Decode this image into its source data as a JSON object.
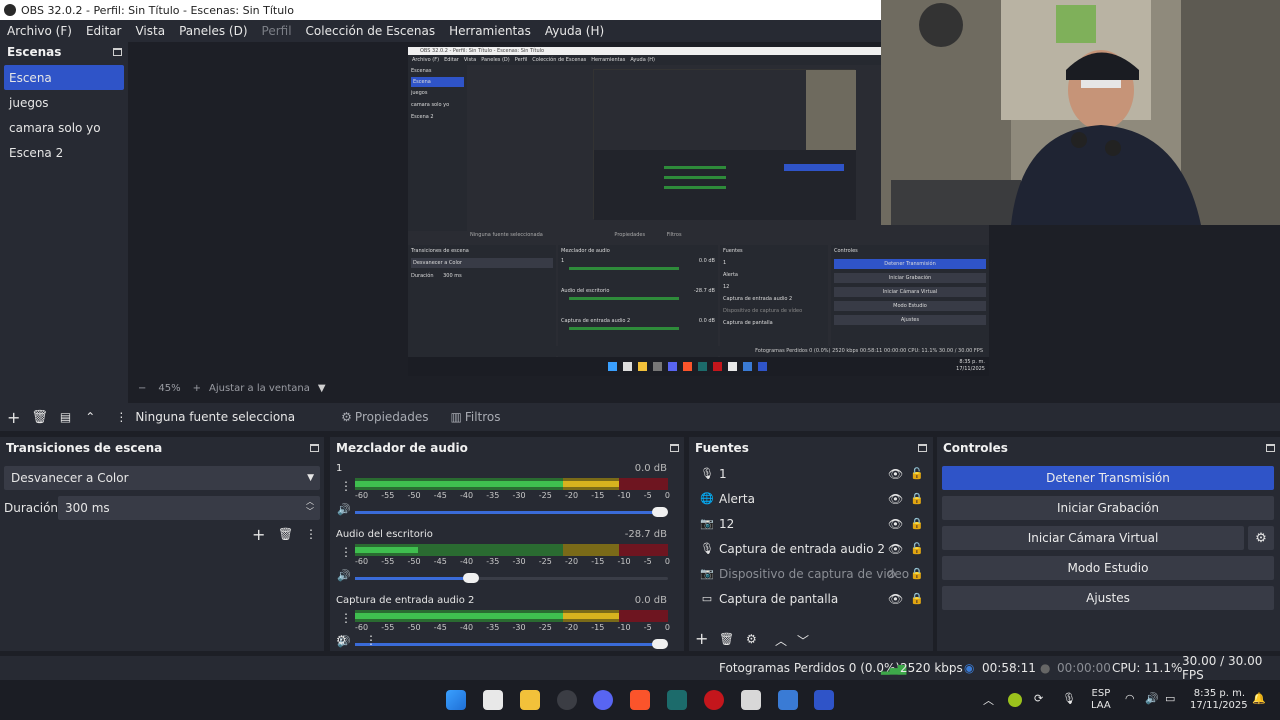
{
  "window": {
    "title": "OBS 32.0.2 - Perfil: Sin Título - Escenas: Sin Título"
  },
  "menu": {
    "items": [
      "Archivo (F)",
      "Editar",
      "Vista",
      "Paneles (D)",
      "Perfil",
      "Colección de Escenas",
      "Herramientas",
      "Ayuda (H)"
    ]
  },
  "scenes": {
    "title": "Escenas",
    "items": [
      "Escena",
      "juegos",
      "camara solo yo",
      "Escena 2"
    ]
  },
  "preview": {
    "zoom_minus": "−",
    "zoom": "45%",
    "zoom_plus": "+",
    "fit": "Ajustar a la ventana"
  },
  "nested": {
    "title": "OBS 32.0.2 - Perfil: Sin Título - Escenas: Sin Título",
    "menu": [
      "Archivo (F)",
      "Editar",
      "Vista",
      "Paneles (D)",
      "Perfil",
      "Colección de Escenas",
      "Herramientas",
      "Ayuda (H)"
    ],
    "scenes_title": "Escenas",
    "scenes": [
      "Escena",
      "juegos",
      "camara solo yo",
      "Escena 2"
    ],
    "no_source": "Ninguna fuente seleccionada",
    "props": "Propiedades",
    "filters": "Filtros",
    "trans_title": "Transiciones de escena",
    "trans_value": "Desvanecer a Color",
    "duration_label": "Duración",
    "duration_value": "300 ms",
    "mixer_title": "Mezclador de audio",
    "mixer_ch1": "1",
    "mixer_ch1_db": "0.0 dB",
    "mixer_ch2": "Audio del escritorio",
    "mixer_ch2_db": "-28.7 dB",
    "mixer_ch3": "Captura de entrada audio 2",
    "mixer_ch3_db": "0.0 dB",
    "sources_title": "Fuentes",
    "sources": [
      "1",
      "Alerta",
      "12",
      "Captura de entrada audio 2",
      "Dispositivo de captura de vídeo",
      "Captura de pantalla"
    ],
    "controls_title": "Controles",
    "controls": [
      "Detener Transmisión",
      "Iniciar Grabación",
      "Iniciar Cámara Virtual",
      "Modo Estudio",
      "Ajustes"
    ],
    "status": "Fotogramas Perdidos 0 (0.0%)   2520 kbps   00:58:11   00:00:00   CPU: 11.1%   30.00 / 30.00 FPS",
    "clock_time": "8:35 p. m.",
    "clock_date": "17/11/2025"
  },
  "source_bar": {
    "no_source": "Ninguna fuente selecciona",
    "properties": "Propiedades",
    "filters": "Filtros"
  },
  "transitions": {
    "title": "Transiciones de escena",
    "selected": "Desvanecer a Color",
    "duration_label": "Duración",
    "duration_value": "300 ms"
  },
  "mixer": {
    "title": "Mezclador de audio",
    "scale": [
      "-60",
      "-55",
      "-50",
      "-45",
      "-40",
      "-35",
      "-30",
      "-25",
      "-20",
      "-15",
      "-10",
      "-5",
      "0"
    ],
    "channels": [
      {
        "name": "1",
        "db": "0.0 dB",
        "level": 0.96,
        "volume": 1.0
      },
      {
        "name": "Audio del escritorio",
        "db": "-28.7 dB",
        "level": 0.2,
        "volume": 0.38
      },
      {
        "name": "Captura de entrada audio 2",
        "db": "0.0 dB",
        "level": 0.9,
        "volume": 1.0
      }
    ]
  },
  "sources": {
    "title": "Fuentes",
    "items": [
      {
        "name": "1",
        "icon": "microphone-icon",
        "visible": true,
        "locked": false
      },
      {
        "name": "Alerta",
        "icon": "browser-icon",
        "visible": true,
        "locked": true
      },
      {
        "name": "12",
        "icon": "camera-icon",
        "visible": true,
        "locked": true
      },
      {
        "name": "Captura de entrada audio 2",
        "icon": "microphone-icon",
        "visible": true,
        "locked": false
      },
      {
        "name": "Dispositivo de captura de video",
        "icon": "camera-icon",
        "visible": false,
        "locked": true
      },
      {
        "name": "Captura de pantalla",
        "icon": "monitor-icon",
        "visible": true,
        "locked": true
      }
    ]
  },
  "controls": {
    "title": "Controles",
    "stop_stream": "Detener Transmisión",
    "start_recording": "Iniciar Grabación",
    "start_virtual_cam": "Iniciar Cámara Virtual",
    "studio_mode": "Modo Estudio",
    "settings": "Ajustes"
  },
  "status": {
    "dropped": "Fotogramas Perdidos 0 (0.0%)",
    "bitrate": "2520 kbps",
    "stream_time": "00:58:11",
    "rec_time": "00:00:00",
    "cpu": "CPU: 11.1%",
    "fps": "30.00 / 30.00 FPS"
  },
  "taskbar": {
    "lang": "ESP",
    "layout": "LAA",
    "time": "8:35 p. m.",
    "date": "17/11/2025"
  },
  "colors": {
    "accent": "#2f54c8",
    "panel": "#272a33",
    "background": "#1d1f26",
    "meter_green": "#2e8b3a",
    "meter_yellow": "#a08a1e",
    "meter_red": "#8c1c2a"
  }
}
